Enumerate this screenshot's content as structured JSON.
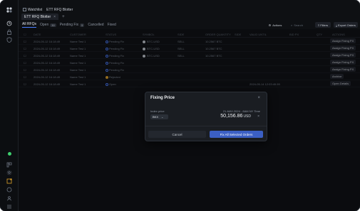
{
  "window": {
    "tabs": [
      {
        "label": "Watchlist"
      },
      {
        "label": "ETT RFQ Blotter"
      }
    ]
  },
  "app_tabs": [
    {
      "label": "ETT RFQ Blotter",
      "close": "×"
    }
  ],
  "app_tab_add": "+",
  "filters": [
    {
      "label": "All RFQs",
      "count": "",
      "active": true
    },
    {
      "label": "Open",
      "count": "30",
      "active": false
    },
    {
      "label": "Pending Fix",
      "count": "5",
      "active": false
    },
    {
      "label": "Cancelled",
      "count": "",
      "active": false
    },
    {
      "label": "Fixed",
      "count": "",
      "active": false
    }
  ],
  "toolbar": {
    "actions_label": "Actions",
    "search_placeholder": "Search",
    "filters_label": "Filters",
    "export_label": "Export Orders"
  },
  "table": {
    "columns": [
      "DATE",
      "CUSTOMER",
      "STATUS",
      "SYMBOL",
      "SIDE",
      "ORDER QUANTITY",
      "SIDE",
      "VALID UNTIL",
      "BID PX",
      "QTY",
      "ACTIONS"
    ],
    "rows": [
      {
        "date": "2024-05-12 16:18:49",
        "customer": "Name Test 1",
        "status": "Pending Fix",
        "symbol": "BTC-USD",
        "side": "SELL",
        "qty": "10.2567 BTC",
        "status_type": "pending",
        "action": "Assign Fixing PX"
      },
      {
        "date": "2024-05-12 16:18:49",
        "customer": "Name Test 1",
        "status": "Pending Fix",
        "symbol": "BTC-USD",
        "side": "SELL",
        "qty": "10.2567 BTC",
        "status_type": "pending",
        "action": "Assign Fixing PX"
      },
      {
        "date": "2024-05-12 16:18:49",
        "customer": "Name Test 1",
        "status": "Pending Fix",
        "symbol": "BTC-USD",
        "side": "SELL",
        "qty": "10.2567 BTC",
        "status_type": "pending",
        "action": "Assign Fixing PX"
      },
      {
        "date": "2024-05-12 16:18:49",
        "customer": "Name Test 1",
        "status": "Pending Fix",
        "symbol": "",
        "side": "",
        "qty": "",
        "status_type": "pending",
        "action": "Assign Fixing PX"
      },
      {
        "date": "2024-05-12 16:18:49",
        "customer": "Name Test 1",
        "status": "Pending Fix",
        "symbol": "",
        "side": "",
        "qty": "",
        "status_type": "pending",
        "action": "Assign Fixing PX"
      },
      {
        "date": "2024-05-12 16:18:49",
        "customer": "Name Test 1",
        "status": "Rejected",
        "symbol": "",
        "side": "",
        "qty": "",
        "status_type": "rejected",
        "action": "Archive"
      },
      {
        "date": "2024-05-12 16:18:49",
        "customer": "Name Test 1",
        "status": "Open",
        "symbol": "",
        "side": "",
        "qty": "",
        "status_type": "open",
        "valid_until": "2024-05-14 12:03:49.99",
        "action": "Open Details"
      }
    ]
  },
  "modal": {
    "title": "Fixing Price",
    "close": "×",
    "price_label": "Index price",
    "timestamp": "21-MAY-2024 - 8AM NY Time",
    "source": "BKX",
    "price": "50,156.86",
    "unit": "USD",
    "cancel_label": "Cancel",
    "confirm_label": "Fix All Selected Orders"
  },
  "colors": {
    "accent": "#3b5fc4",
    "pending": "#4a7dff",
    "rejected": "#e0a42b",
    "status_ok": "#3ecf6e"
  }
}
